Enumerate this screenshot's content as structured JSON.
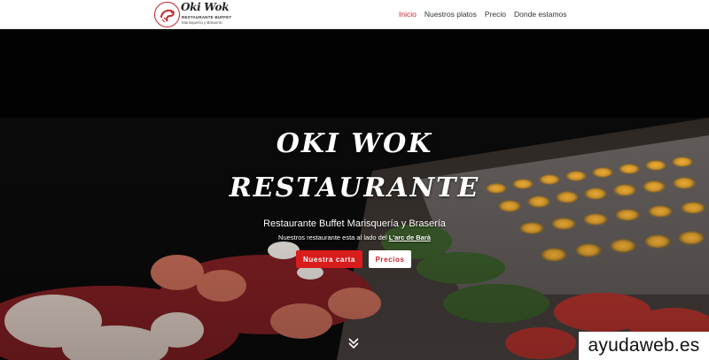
{
  "header": {
    "logo": {
      "name": "Oki Wok",
      "line1": "RESTAURANTE BUFFET",
      "line2": "Marisquería y Brasería"
    },
    "nav": [
      {
        "label": "Inicio",
        "active": true
      },
      {
        "label": "Nuestros platos",
        "active": false
      },
      {
        "label": "Precio",
        "active": false
      },
      {
        "label": "Donde estamos",
        "active": false
      }
    ]
  },
  "hero": {
    "title_line1": "OKI WOK",
    "title_line2": "RESTAURANTE",
    "subtitle": "Restaurante Buffet Marisquería y Brasería",
    "location_text": "Nuestros restaurante esta al lado del ",
    "location_link": "L'arc de Barà",
    "buttons": {
      "primary": "Nuestra carta",
      "secondary": "Precios"
    },
    "scroll_icon": "double-chevron-down-icon"
  },
  "watermark": "ayudaweb.es",
  "colors": {
    "accent": "#c6282c",
    "button_red": "#d91c1c"
  }
}
